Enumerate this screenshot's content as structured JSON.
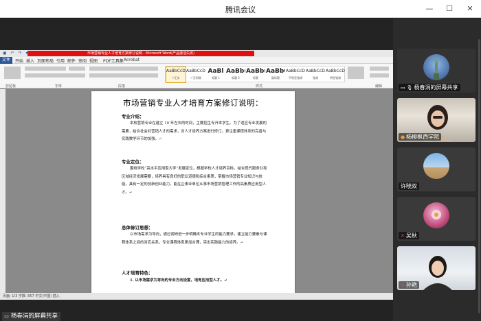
{
  "window": {
    "title": "腾讯会议",
    "minimize_icon": "—",
    "maximize_icon": "☐",
    "close_icon": "✕"
  },
  "word": {
    "titlebar_text": "市场营销专业人才培育方案修订说明 - Microsoft Word(产品激活失败)",
    "quick_access": "▣ ↶ ↷ ▾",
    "file_tab": "文件",
    "tabs": [
      "开始",
      "插入",
      "页面布局",
      "引用",
      "邮件",
      "审阅",
      "视图",
      "PDF工具集",
      "Acrobat"
    ],
    "ribbon_groups": [
      "剪贴板",
      "字体",
      "段落",
      "样式",
      "编辑"
    ],
    "styles": [
      {
        "sample": "AaBbCcDd",
        "label": "↵正文",
        "selected": true,
        "big": false
      },
      {
        "sample": "AaBbCcDd",
        "label": "↵无间隔",
        "selected": false,
        "big": false
      },
      {
        "sample": "AaBl",
        "label": "标题 1",
        "selected": false,
        "big": true
      },
      {
        "sample": "AaBb(",
        "label": "标题 2",
        "selected": false,
        "big": true
      },
      {
        "sample": "AaBb(",
        "label": "标题",
        "selected": false,
        "big": true
      },
      {
        "sample": "AaBbC",
        "label": "副标题",
        "selected": false,
        "big": true
      },
      {
        "sample": "AaBbCcDd",
        "label": "不明显强调",
        "selected": false,
        "big": false
      },
      {
        "sample": "AaBbCcDd",
        "label": "强调",
        "selected": false,
        "big": false
      },
      {
        "sample": "AaBbCcDd",
        "label": "明显强调",
        "selected": false,
        "big": false
      }
    ],
    "status_text": "页面: 1/3   字数: 857   中文(中国)   插入",
    "document": {
      "title": "市场营销专业人才培育方案修订说明：",
      "sections": [
        {
          "heading": "专业介绍：",
          "body": "本校营销专业在建立 10 年左右的时间，主要招生专升本学生。为了适应专业发展的需要，结合社会对营销人才的需求，对人才培养方案进行修订，更注重课程体系的完善与实践教学环节的加强。↵"
        },
        {
          "heading": "专业定位：",
          "body": "围绕学校“高水平应用型大学”发展定位，根据学校人才培养目标，结合现代服务业和区域经济发展需要，培养具有良好的职业道德和综合素质，掌握市场营销专业知识与技能，具有一定的创新创业能力，能在企事业单位从事市场营销管理工作的高素质应用型人才。↵"
        },
        {
          "heading": "总体修订思想：",
          "body": "以市场需求为导向，通过调研进一步明确本专业学生的能力要求，建立能力要素与课程体系之间的对应关系，专业课程体系更加合理，突出实践能力的培养。↵"
        },
        {
          "heading": "人才培育特色：",
          "body": "1. 以市场需求为导向的专业方向设置，培育应用型人才。↵"
        }
      ]
    }
  },
  "share_label": {
    "icon": "monitor-icon",
    "text": "杨春涓的屏幕共享"
  },
  "participants": [
    {
      "name": "杨春涓的屏幕共享",
      "icon": "screen-share-icon",
      "icon_glyph": "▭",
      "mic": "mic-icon"
    },
    {
      "name": "杨柳枫西学院",
      "icon": "user-icon",
      "icon_glyph": "●",
      "mic": "mic-icon"
    },
    {
      "name": "许晓双",
      "icon": "none",
      "icon_glyph": "",
      "mic": ""
    },
    {
      "name": "吴秋",
      "icon": "mic-muted-icon",
      "icon_glyph": "✕",
      "mic": "mic-muted-icon"
    },
    {
      "name": "孙艳",
      "icon": "mic-muted-icon",
      "icon_glyph": "✕",
      "mic": "mic-muted-icon"
    }
  ]
}
